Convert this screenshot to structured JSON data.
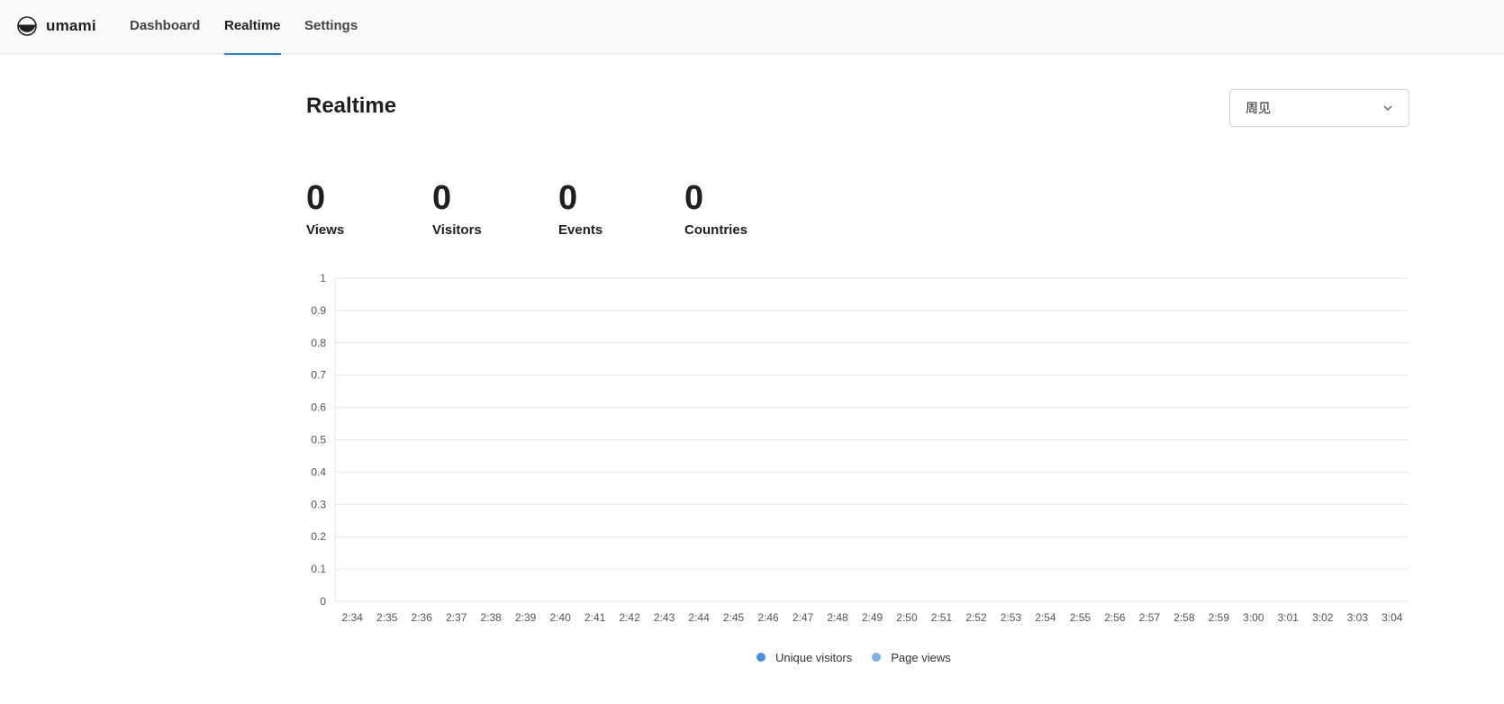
{
  "app": {
    "name": "umami"
  },
  "nav": {
    "items": [
      {
        "label": "Dashboard",
        "active": false
      },
      {
        "label": "Realtime",
        "active": true
      },
      {
        "label": "Settings",
        "active": false
      }
    ]
  },
  "page": {
    "title": "Realtime",
    "dropdown": {
      "selected": "周见"
    }
  },
  "metrics": [
    {
      "value": "0",
      "label": "Views"
    },
    {
      "value": "0",
      "label": "Visitors"
    },
    {
      "value": "0",
      "label": "Events"
    },
    {
      "value": "0",
      "label": "Countries"
    }
  ],
  "colors": {
    "accent": "#2680eb",
    "unique_visitors": "#4a90e2",
    "page_views": "#7fb0ea",
    "grid": "#e6e6e6"
  },
  "chart_data": {
    "type": "bar",
    "categories": [
      "2:34",
      "2:35",
      "2:36",
      "2:37",
      "2:38",
      "2:39",
      "2:40",
      "2:41",
      "2:42",
      "2:43",
      "2:44",
      "2:45",
      "2:46",
      "2:47",
      "2:48",
      "2:49",
      "2:50",
      "2:51",
      "2:52",
      "2:53",
      "2:54",
      "2:55",
      "2:56",
      "2:57",
      "2:58",
      "2:59",
      "3:00",
      "3:01",
      "3:02",
      "3:03",
      "3:04"
    ],
    "series": [
      {
        "name": "Unique visitors",
        "values": [
          0,
          0,
          0,
          0,
          0,
          0,
          0,
          0,
          0,
          0,
          0,
          0,
          0,
          0,
          0,
          0,
          0,
          0,
          0,
          0,
          0,
          0,
          0,
          0,
          0,
          0,
          0,
          0,
          0,
          0,
          0
        ]
      },
      {
        "name": "Page views",
        "values": [
          0,
          0,
          0,
          0,
          0,
          0,
          0,
          0,
          0,
          0,
          0,
          0,
          0,
          0,
          0,
          0,
          0,
          0,
          0,
          0,
          0,
          0,
          0,
          0,
          0,
          0,
          0,
          0,
          0,
          0,
          0
        ]
      }
    ],
    "yticks": [
      "0",
      "0.1",
      "0.2",
      "0.3",
      "0.4",
      "0.5",
      "0.6",
      "0.7",
      "0.8",
      "0.9",
      "1"
    ],
    "ylim": [
      0,
      1
    ],
    "grid": true,
    "legend": "bottom-center"
  }
}
